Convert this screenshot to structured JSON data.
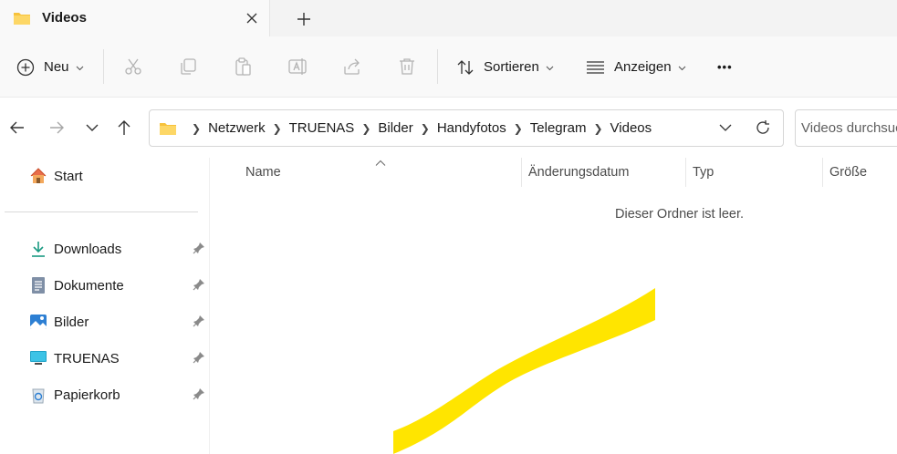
{
  "tab": {
    "title": "Videos"
  },
  "toolbar": {
    "new_label": "Neu",
    "sort_label": "Sortieren",
    "view_label": "Anzeigen",
    "more_label": "•••"
  },
  "address": {
    "crumbs": [
      "Netzwerk",
      "TRUENAS",
      "Bilder",
      "Handyfotos",
      "Telegram",
      "Videos"
    ]
  },
  "search": {
    "placeholder": "Videos durchsuchen"
  },
  "sidebar": {
    "home": "Start",
    "items": [
      {
        "label": "Downloads",
        "icon": "download-icon"
      },
      {
        "label": "Dokumente",
        "icon": "document-icon"
      },
      {
        "label": "Bilder",
        "icon": "pictures-icon"
      },
      {
        "label": "TRUENAS",
        "icon": "monitor-icon"
      },
      {
        "label": "Papierkorb",
        "icon": "recycle-bin-icon"
      }
    ]
  },
  "columns": {
    "name": "Name",
    "modified": "Änderungsdatum",
    "type": "Typ",
    "size": "Größe"
  },
  "content": {
    "empty_message": "Dieser Ordner ist leer."
  },
  "colors": {
    "folder": "#f7c23b",
    "accent": "#0067c0",
    "highlighter": "#ffe500"
  }
}
